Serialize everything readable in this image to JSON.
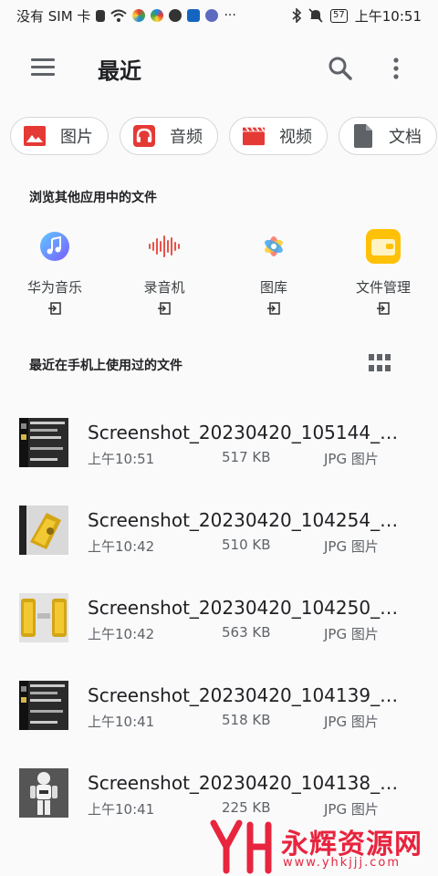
{
  "status_bar": {
    "carrier": "没有 SIM 卡",
    "battery": "57",
    "time": "上午10:51"
  },
  "app_bar": {
    "title": "最近",
    "menu_icon": "hamburger-menu-icon",
    "search_icon": "search-icon",
    "more_icon": "more-vert-icon"
  },
  "categories": [
    {
      "label": "图片",
      "icon": "image-icon",
      "color": "#e53935"
    },
    {
      "label": "音频",
      "icon": "headphones-icon",
      "color": "#e53935"
    },
    {
      "label": "视频",
      "icon": "clapperboard-icon",
      "color": "#e53935"
    },
    {
      "label": "文档",
      "icon": "document-icon",
      "color": "#5f6368"
    }
  ],
  "browse_section": {
    "label": "浏览其他应用中的文件",
    "apps": [
      {
        "name": "华为音乐",
        "icon": "music-app-icon"
      },
      {
        "name": "录音机",
        "icon": "recorder-app-icon"
      },
      {
        "name": "图库",
        "icon": "gallery-app-icon"
      },
      {
        "name": "文件管理",
        "icon": "file-manager-app-icon"
      }
    ]
  },
  "recent_section": {
    "label": "最近在手机上使用过的文件",
    "view_icon": "grid-view-icon"
  },
  "files": [
    {
      "name": "Screenshot_20230420_105144_co...",
      "time": "上午10:51",
      "size": "517 KB",
      "type": "JPG 图片",
      "thumb": "dark"
    },
    {
      "name": "Screenshot_20230420_104254_co...",
      "time": "上午10:42",
      "size": "510 KB",
      "type": "JPG 图片",
      "thumb": "gold"
    },
    {
      "name": "Screenshot_20230420_104250_co...",
      "time": "上午10:42",
      "size": "563 KB",
      "type": "JPG 图片",
      "thumb": "gold2"
    },
    {
      "name": "Screenshot_20230420_104139_co...",
      "time": "上午10:41",
      "size": "518 KB",
      "type": "JPG 图片",
      "thumb": "dark"
    },
    {
      "name": "Screenshot_20230420_104138_co...",
      "time": "上午10:41",
      "size": "225 KB",
      "type": "JPG 图片",
      "thumb": "robot"
    }
  ],
  "watermark": {
    "title": "永辉资源网",
    "url": "www.yhkjjj.com"
  }
}
